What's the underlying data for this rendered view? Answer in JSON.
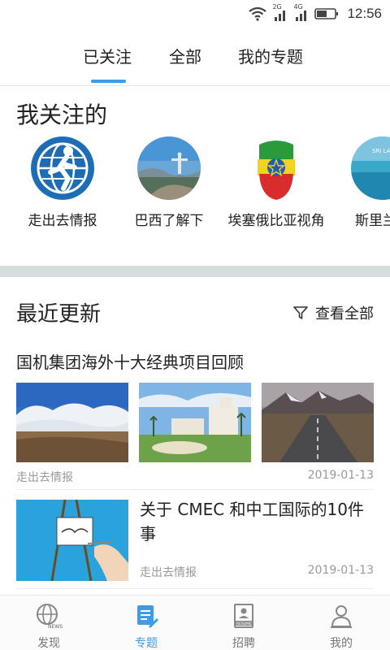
{
  "status_bar": {
    "network_left": "2G",
    "network_right": "4G",
    "time": "12:56"
  },
  "tabs": [
    {
      "label": "已关注",
      "active": true
    },
    {
      "label": "全部",
      "active": false
    },
    {
      "label": "我的专题",
      "active": false
    }
  ],
  "following": {
    "title": "我关注的",
    "items": [
      {
        "label": "走出去情报",
        "icon": "globe-runner-icon"
      },
      {
        "label": "巴西了解下",
        "icon": "rio-statue-photo"
      },
      {
        "label": "埃塞俄比亚视角",
        "icon": "ethiopia-flag-face-photo"
      },
      {
        "label": "斯里兰卡",
        "icon": "sri-lanka-photo"
      }
    ]
  },
  "recent": {
    "title": "最近更新",
    "view_all": "查看全部",
    "articles": [
      {
        "title": "国机集团海外十大经典项目回顾",
        "source": "走出去情报",
        "date": "2019-01-13"
      },
      {
        "title": "关于 CMEC 和中工国际的10件事",
        "source": "走出去情报",
        "date": "2019-01-13"
      }
    ]
  },
  "bottom_nav": [
    {
      "label": "发现",
      "icon": "globe-news-icon",
      "active": false
    },
    {
      "label": "专题",
      "icon": "topic-doc-icon",
      "active": true
    },
    {
      "label": "招聘",
      "icon": "resume-icon",
      "active": false
    },
    {
      "label": "我的",
      "icon": "user-profile-icon",
      "active": false
    }
  ],
  "colors": {
    "accent": "#3f9be6",
    "divider": "#d5dddf",
    "meta_text": "#999999"
  }
}
